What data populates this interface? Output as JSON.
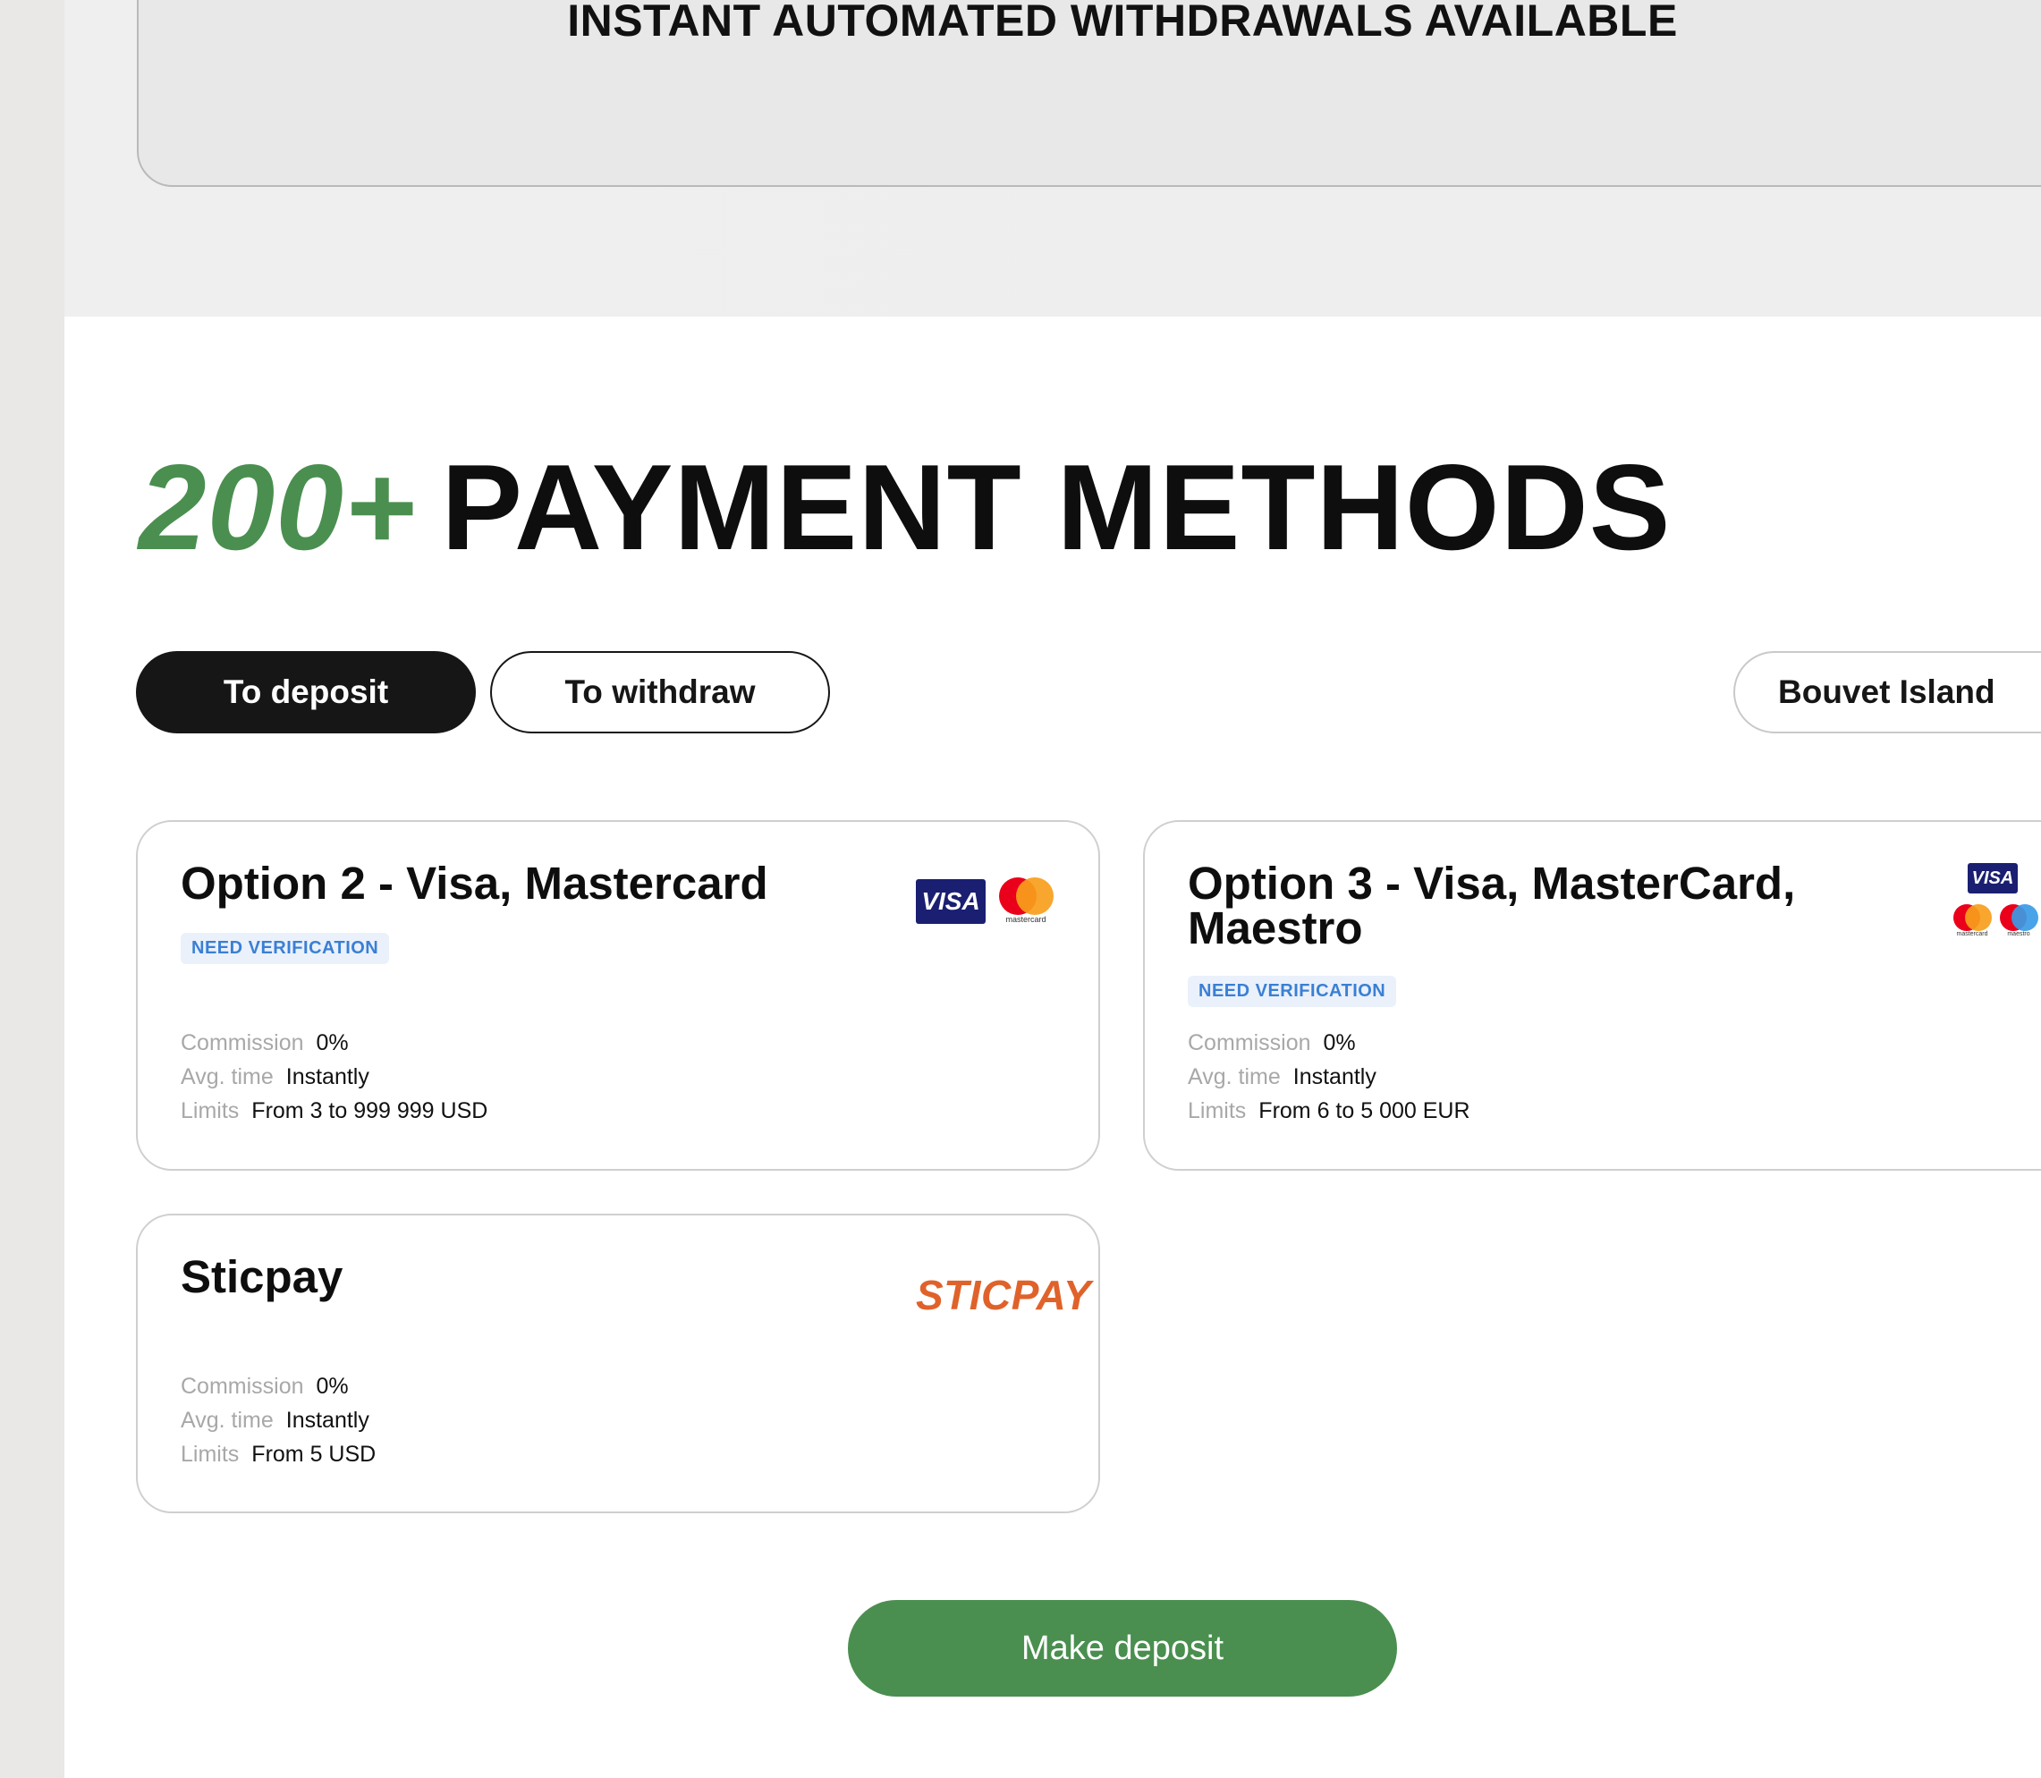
{
  "banner": {
    "text": "INSTANT AUTOMATED WITHDRAWALS AVAILABLE"
  },
  "headline": {
    "accent": "200+",
    "rest": "PAYMENT METHODS"
  },
  "tabs": {
    "deposit": "To deposit",
    "withdraw": "To withdraw",
    "active": "deposit"
  },
  "country": {
    "selected": "Bouvet Island"
  },
  "labels": {
    "commission": "Commission",
    "avg_time": "Avg. time",
    "limits": "Limits"
  },
  "methods": [
    {
      "title": "Option 2 - Visa, Mastercard",
      "badge": "NEED VERIFICATION",
      "commission": "0%",
      "avg_time": "Instantly",
      "limits": "From 3 to 999 999 USD",
      "logos": [
        "visa-logo",
        "mastercard-logo"
      ],
      "logo_text": {
        "visa": "VISA",
        "mastercard": "mastercard"
      }
    },
    {
      "title": "Option 3 - Visa, MasterCard, Maestro",
      "badge": "NEED VERIFICATION",
      "commission": "0%",
      "avg_time": "Instantly",
      "limits": "From 6 to 5 000 EUR",
      "logos": [
        "visa-logo",
        "mastercard-logo",
        "maestro-logo"
      ],
      "logo_text": {
        "visa": "VISA",
        "mastercard": "mastercard",
        "maestro": "maestro"
      }
    },
    {
      "title": "Sticpay",
      "commission": "0%",
      "avg_time": "Instantly",
      "limits": "From 5 USD",
      "logos": [
        "sticpay-logo"
      ],
      "logo_text": {
        "sticpay": "STICPAY"
      }
    }
  ],
  "cta": {
    "label": "Make deposit"
  },
  "colors": {
    "accent_green": "#4a8f4f",
    "badge_blue": "#3a7fd4",
    "sticpay_orange": "#e0622b",
    "visa_navy": "#1a1f71",
    "tab_active_bg": "#161616"
  }
}
